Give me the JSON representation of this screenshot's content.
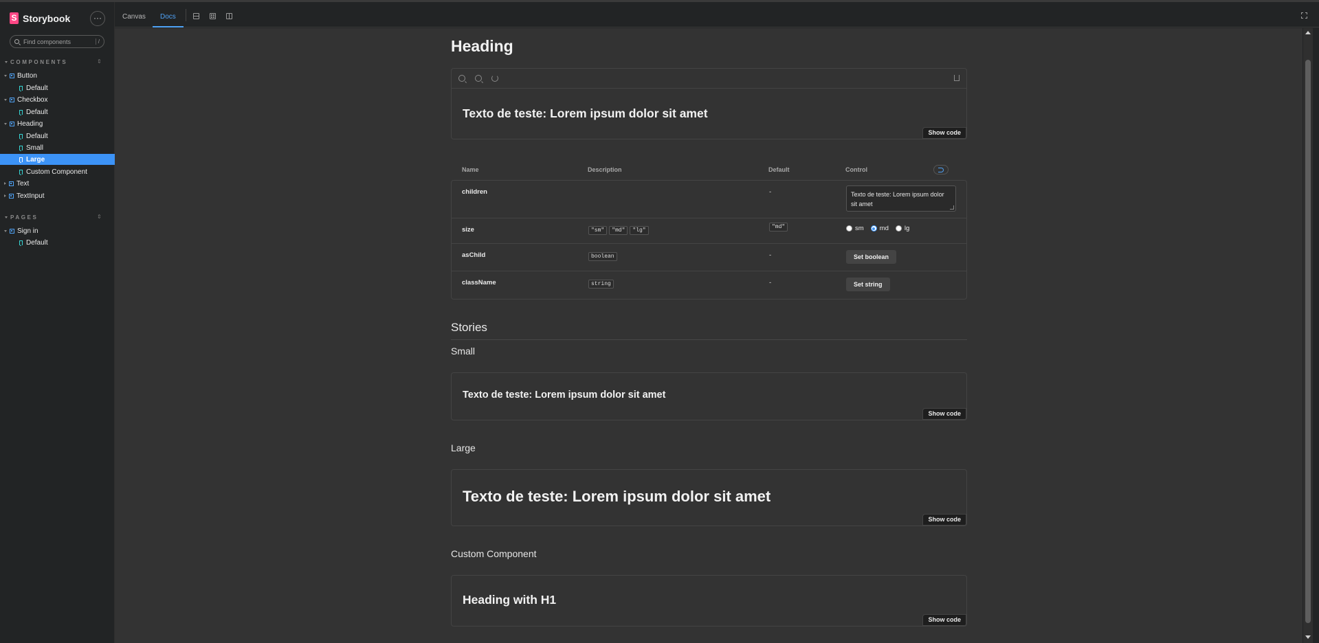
{
  "sidebar": {
    "brand": "Storybook",
    "menu_glyph": "···",
    "search_placeholder": "Find components",
    "search_shortcut": "/",
    "components_label": "COMPONENTS",
    "pages_label": "PAGES",
    "items": [
      {
        "label": "Button",
        "kind": "component"
      },
      {
        "label": "Default",
        "kind": "story"
      },
      {
        "label": "Checkbox",
        "kind": "component"
      },
      {
        "label": "Default",
        "kind": "story"
      },
      {
        "label": "Heading",
        "kind": "component"
      },
      {
        "label": "Default",
        "kind": "story"
      },
      {
        "label": "Small",
        "kind": "story"
      },
      {
        "label": "Large",
        "kind": "story",
        "active": true
      },
      {
        "label": "Custom Component",
        "kind": "story"
      },
      {
        "label": "Text",
        "kind": "component"
      },
      {
        "label": "TextInput",
        "kind": "component"
      }
    ],
    "page_items": [
      {
        "label": "Sign in",
        "kind": "component"
      },
      {
        "label": "Default",
        "kind": "story"
      }
    ]
  },
  "toolbar": {
    "tabs": [
      "Canvas",
      "Docs"
    ],
    "active_tab": "Docs"
  },
  "docs": {
    "title": "Heading",
    "primary_demo_text": "Texto de teste: Lorem ipsum dolor sit amet",
    "show_code_label": "Show code",
    "args": {
      "headers": {
        "name": "Name",
        "description": "Description",
        "default": "Default",
        "control": "Control"
      },
      "rows": [
        {
          "name": "children",
          "default": "-",
          "control_value": "Texto de teste: Lorem ipsum dolor sit amet"
        },
        {
          "name": "size",
          "description_chips": [
            "\"sm\"",
            "\"md\"",
            "\"lg\""
          ],
          "default_chip": "\"md\"",
          "options": [
            "sm",
            "md",
            "lg"
          ],
          "selected": "md"
        },
        {
          "name": "asChild",
          "description_chips": [
            "boolean"
          ],
          "default": "-",
          "control_label": "Set boolean"
        },
        {
          "name": "className",
          "description_chips": [
            "string"
          ],
          "default": "-",
          "control_label": "Set string"
        }
      ]
    },
    "stories_title": "Stories",
    "stories": [
      {
        "title": "Small",
        "demo_text": "Texto de teste: Lorem ipsum dolor sit amet"
      },
      {
        "title": "Large",
        "demo_text": "Texto de teste: Lorem ipsum dolor sit amet"
      },
      {
        "title": "Custom Component",
        "demo_text": "Heading with H1"
      }
    ]
  },
  "colors": {
    "accent": "#3c93f7",
    "brand": "#ff4785",
    "background": "#333333",
    "sidebar": "#222425"
  }
}
